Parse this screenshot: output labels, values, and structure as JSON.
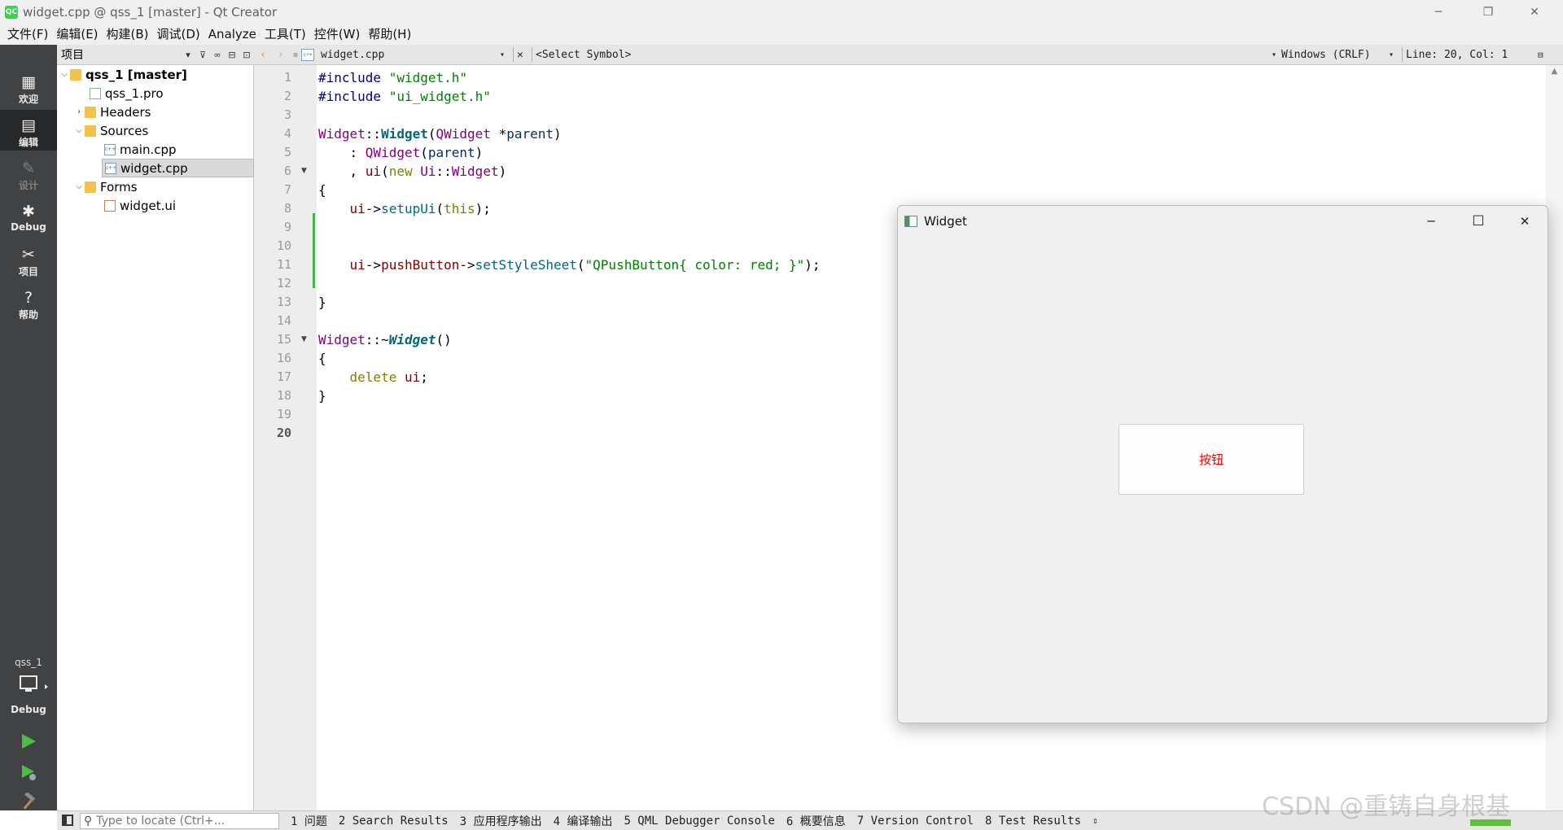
{
  "window": {
    "title": "widget.cpp @ qss_1 [master] - Qt Creator",
    "app_icon": "QC",
    "controls": {
      "minimize": "─",
      "restore": "❐",
      "close": "✕"
    }
  },
  "menu": [
    "文件(F)",
    "编辑(E)",
    "构建(B)",
    "调试(D)",
    "Analyze",
    "工具(T)",
    "控件(W)",
    "帮助(H)"
  ],
  "modes": [
    {
      "label": "欢迎",
      "icon": "grid-icon",
      "glyph": "▦"
    },
    {
      "label": "编辑",
      "icon": "document-icon",
      "glyph": "▤"
    },
    {
      "label": "设计",
      "icon": "pencil-icon",
      "glyph": "✎"
    },
    {
      "label": "Debug",
      "icon": "bug-icon",
      "glyph": "✱"
    },
    {
      "label": "项目",
      "icon": "wrench-icon",
      "glyph": "✂"
    },
    {
      "label": "帮助",
      "icon": "help-icon",
      "glyph": "?"
    }
  ],
  "kit": {
    "project": "qss_1",
    "config": "Debug"
  },
  "project_panel": {
    "title": "项目",
    "tree": [
      {
        "label": "qss_1 [master]",
        "bold": true
      },
      {
        "label": "qss_1.pro"
      },
      {
        "label": "Headers"
      },
      {
        "label": "Sources"
      },
      {
        "label": "main.cpp"
      },
      {
        "label": "widget.cpp",
        "selected": true
      },
      {
        "label": "Forms"
      },
      {
        "label": "widget.ui"
      }
    ]
  },
  "editor_toolbar": {
    "file": "widget.cpp",
    "symbol": "<Select Symbol>",
    "line_endings": "Windows (CRLF)",
    "position": "Line: 20, Col: 1"
  },
  "code": {
    "line_numbers": [
      "1",
      "2",
      "3",
      "4",
      "5",
      "6",
      "7",
      "8",
      "9",
      "10",
      "11",
      "12",
      "13",
      "14",
      "15",
      "16",
      "17",
      "18",
      "19",
      "20"
    ],
    "current_line": "20"
  },
  "status_bar": {
    "locator_placeholder": "Type to locate (Ctrl+...",
    "panes": [
      "1 问题",
      "2 Search Results",
      "3 应用程序输出",
      "4 编译输出",
      "5 QML Debugger Console",
      "6 概要信息",
      "7 Version Control",
      "8 Test Results"
    ]
  },
  "widget_window": {
    "title": "Widget",
    "button_label": "按钮",
    "button_color": "#ff0000"
  },
  "watermark": "CSDN @重铸自身根基",
  "colors": {
    "accent_green": "#41cd52",
    "modebar": "#404244",
    "modebar_active": "#262829"
  }
}
